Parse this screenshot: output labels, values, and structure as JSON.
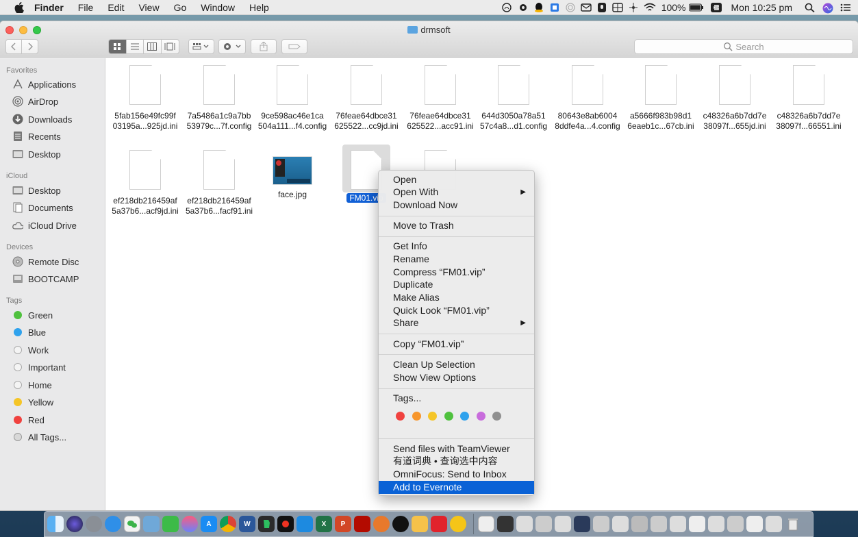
{
  "menubar": {
    "app": "Finder",
    "menus": [
      "File",
      "Edit",
      "View",
      "Go",
      "Window",
      "Help"
    ],
    "battery": "100%",
    "clock": "Mon 10:25 pm"
  },
  "window": {
    "title": "drmsoft",
    "search_placeholder": "Search"
  },
  "sidebar": {
    "favorites_header": "Favorites",
    "favorites": [
      {
        "label": "Applications",
        "icon": "applications-icon"
      },
      {
        "label": "AirDrop",
        "icon": "airdrop-icon"
      },
      {
        "label": "Downloads",
        "icon": "downloads-icon"
      },
      {
        "label": "Recents",
        "icon": "recents-icon"
      },
      {
        "label": "Desktop",
        "icon": "desktop-icon"
      }
    ],
    "icloud_header": "iCloud",
    "icloud": [
      {
        "label": "Desktop",
        "icon": "desktop-icon"
      },
      {
        "label": "Documents",
        "icon": "documents-icon"
      },
      {
        "label": "iCloud Drive",
        "icon": "cloud-icon"
      }
    ],
    "devices_header": "Devices",
    "devices": [
      {
        "label": "Remote Disc",
        "icon": "disc-icon"
      },
      {
        "label": "BOOTCAMP",
        "icon": "drive-icon"
      }
    ],
    "tags_header": "Tags",
    "tags": [
      {
        "label": "Green",
        "color": "#4fc13e"
      },
      {
        "label": "Blue",
        "color": "#2fa2ed"
      },
      {
        "label": "Work",
        "color": ""
      },
      {
        "label": "Important",
        "color": ""
      },
      {
        "label": "Home",
        "color": ""
      },
      {
        "label": "Yellow",
        "color": "#f5c527"
      },
      {
        "label": "Red",
        "color": "#f0423f"
      },
      {
        "label": "All Tags...",
        "color": "all"
      }
    ]
  },
  "files": [
    {
      "line1": "5fab156e49fc99f",
      "line2": "03195a...925jd.ini"
    },
    {
      "line1": "7a5486a1c9a7bb",
      "line2": "53979c...7f.config"
    },
    {
      "line1": "9ce598ac46e1ca",
      "line2": "504a111...f4.config"
    },
    {
      "line1": "76feae64dbce31",
      "line2": "625522...cc9jd.ini"
    },
    {
      "line1": "76feae64dbce31",
      "line2": "625522...acc91.ini"
    },
    {
      "line1": "644d3050a78a51",
      "line2": "57c4a8...d1.config"
    },
    {
      "line1": "80643e8ab6004",
      "line2": "8ddfe4a...4.config"
    },
    {
      "line1": "a5666f983b98d1",
      "line2": "6eaeb1c...67cb.ini"
    },
    {
      "line1": "c48326a6b7dd7e",
      "line2": "38097f...655jd.ini"
    },
    {
      "line1": "c48326a6b7dd7e",
      "line2": "38097f...66551.ini"
    },
    {
      "line1": "ef218db216459af",
      "line2": "5a37b6...acf9jd.ini"
    },
    {
      "line1": "ef218db216459af",
      "line2": "5a37b6...facf91.ini"
    },
    {
      "line1": "face.jpg",
      "line2": ""
    },
    {
      "line1": "FM01.vip",
      "line2": ""
    }
  ],
  "context_menu": {
    "open": "Open",
    "open_with": "Open With",
    "download_now": "Download Now",
    "move_to_trash": "Move to Trash",
    "get_info": "Get Info",
    "rename": "Rename",
    "compress": "Compress “FM01.vip”",
    "duplicate": "Duplicate",
    "make_alias": "Make Alias",
    "quick_look": "Quick Look “FM01.vip”",
    "share": "Share",
    "copy": "Copy “FM01.vip”",
    "clean_up": "Clean Up Selection",
    "show_view_options": "Show View Options",
    "tags": "Tags...",
    "tag_colors": [
      "#f0423f",
      "#f7962c",
      "#f5c527",
      "#4fc13e",
      "#2fa2ed",
      "#c86cdc",
      "#909090"
    ],
    "teamviewer": "Send files with TeamViewer",
    "youdao": "有道词典 • 查询选中内容",
    "omnifocus": "OmniFocus: Send to Inbox",
    "evernote": "Add to Evernote"
  },
  "colors": {
    "selection": "#0a62d6"
  }
}
